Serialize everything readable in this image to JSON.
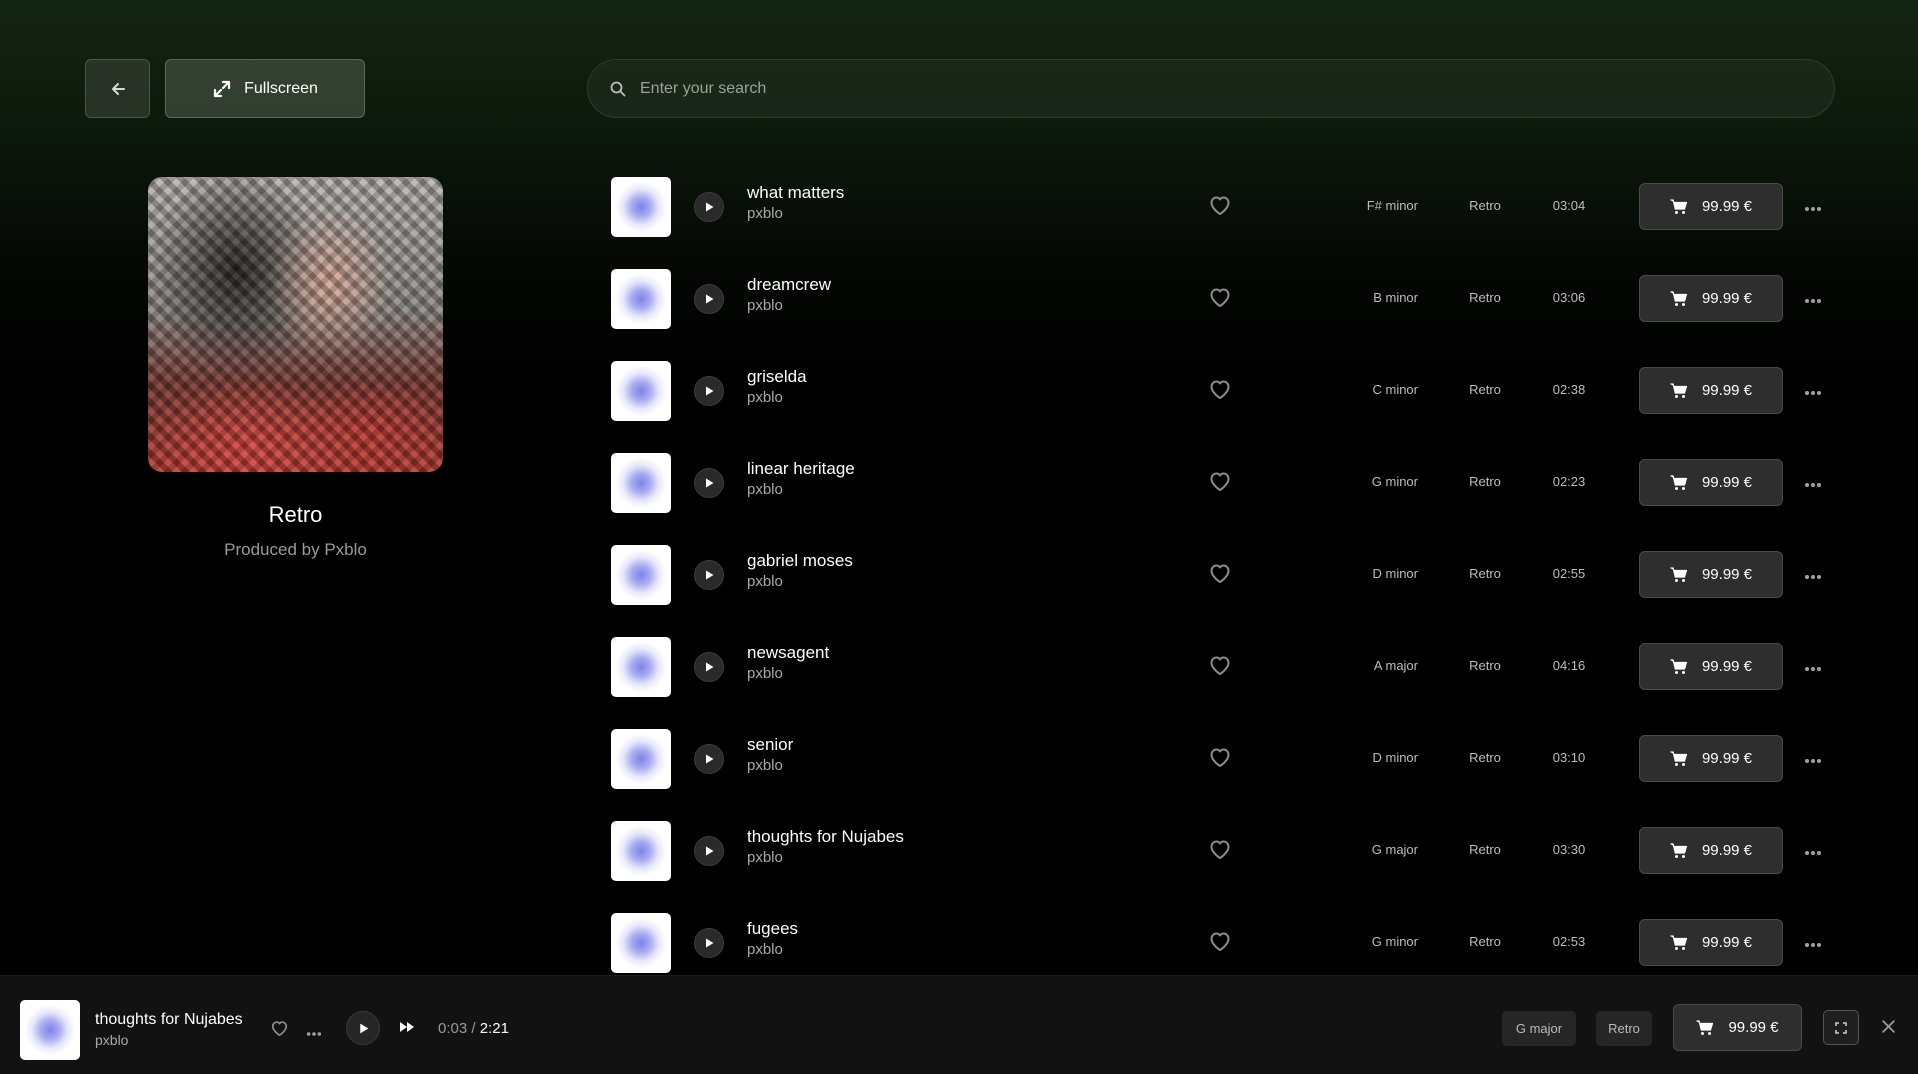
{
  "header": {
    "back_icon": "arrow-left-icon",
    "fullscreen_label": "Fullscreen",
    "fullscreen_icon": "expand-diagonal-icon",
    "search_placeholder": "Enter your search",
    "search_value": ""
  },
  "album": {
    "title": "Retro",
    "subtitle": "Produced by Pxblo"
  },
  "tracks": [
    {
      "title": "what matters",
      "artist": "pxblo",
      "key": "F# minor",
      "genre": "Retro",
      "duration": "03:04",
      "price": "99.99 €"
    },
    {
      "title": "dreamcrew",
      "artist": "pxblo",
      "key": "B minor",
      "genre": "Retro",
      "duration": "03:06",
      "price": "99.99 €"
    },
    {
      "title": "griselda",
      "artist": "pxblo",
      "key": "C minor",
      "genre": "Retro",
      "duration": "02:38",
      "price": "99.99 €"
    },
    {
      "title": "linear heritage",
      "artist": "pxblo",
      "key": "G minor",
      "genre": "Retro",
      "duration": "02:23",
      "price": "99.99 €"
    },
    {
      "title": "gabriel moses",
      "artist": "pxblo",
      "key": "D minor",
      "genre": "Retro",
      "duration": "02:55",
      "price": "99.99 €"
    },
    {
      "title": "newsagent",
      "artist": "pxblo",
      "key": "A major",
      "genre": "Retro",
      "duration": "04:16",
      "price": "99.99 €"
    },
    {
      "title": "senior",
      "artist": "pxblo",
      "key": "D minor",
      "genre": "Retro",
      "duration": "03:10",
      "price": "99.99 €"
    },
    {
      "title": "thoughts for Nujabes",
      "artist": "pxblo",
      "key": "G major",
      "genre": "Retro",
      "duration": "03:30",
      "price": "99.99 €"
    },
    {
      "title": "fugees",
      "artist": "pxblo",
      "key": "G minor",
      "genre": "Retro",
      "duration": "02:53",
      "price": "99.99 €"
    }
  ],
  "player": {
    "title": "thoughts for Nujabes",
    "artist": "pxblo",
    "current_time": "0:03",
    "separator": " / ",
    "total_time": "2:21",
    "key": "G major",
    "genre": "Retro",
    "price": "99.99 €"
  },
  "colors": {
    "accent_thumb": "#7f83e8",
    "header_green": "#142412",
    "background": "#000000"
  }
}
